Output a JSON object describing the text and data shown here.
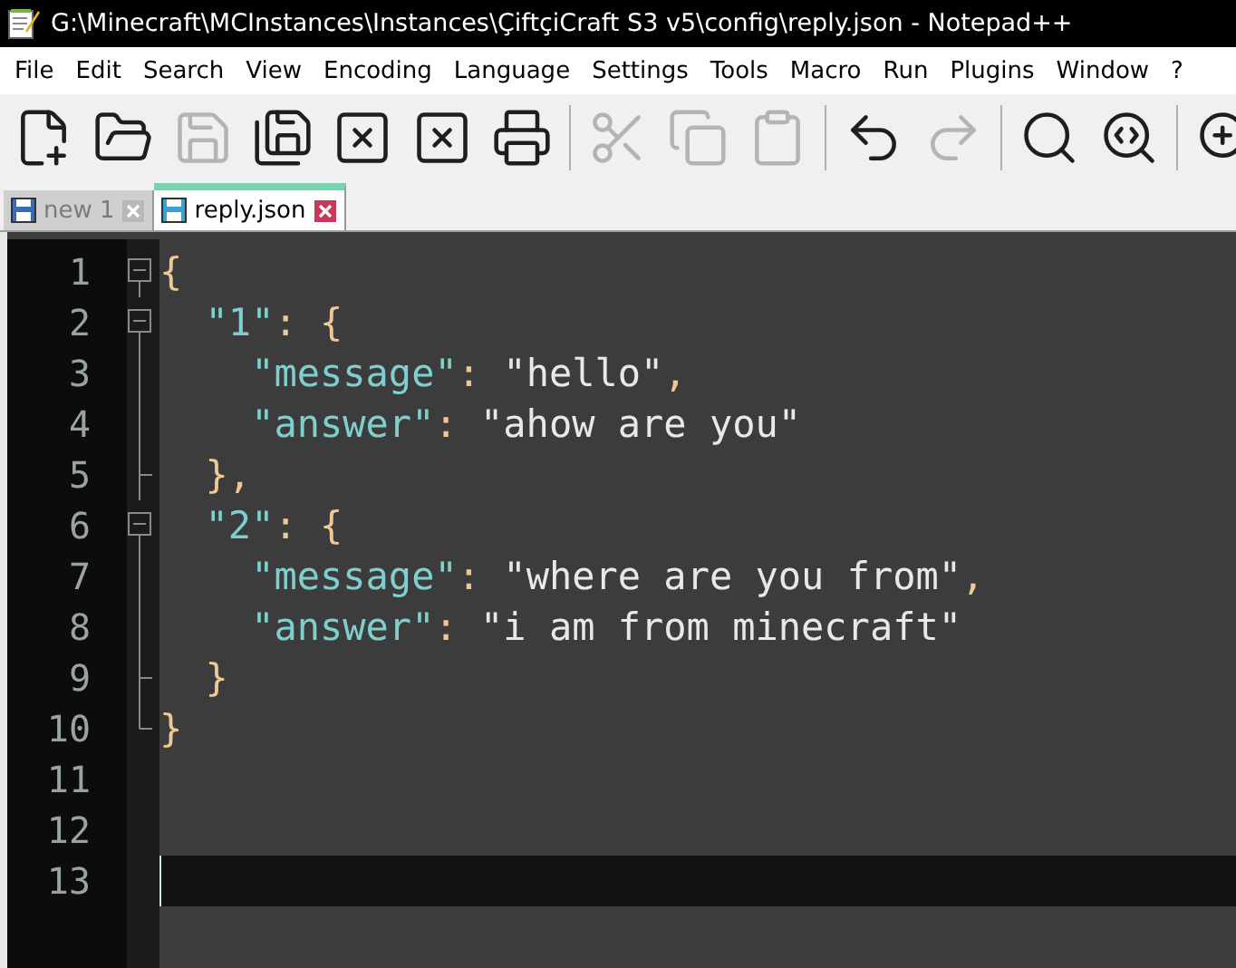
{
  "window": {
    "title": "G:\\Minecraft\\MCInstances\\Instances\\ÇiftçiCraft S3 v5\\config\\reply.json - Notepad++"
  },
  "menu": [
    "File",
    "Edit",
    "Search",
    "View",
    "Encoding",
    "Language",
    "Settings",
    "Tools",
    "Macro",
    "Run",
    "Plugins",
    "Window",
    "?"
  ],
  "toolbar": [
    {
      "kind": "new",
      "disabled": false
    },
    {
      "kind": "open",
      "disabled": false
    },
    {
      "kind": "save",
      "disabled": true
    },
    {
      "kind": "saveall",
      "disabled": false
    },
    {
      "kind": "close",
      "disabled": false
    },
    {
      "kind": "closeall",
      "disabled": false
    },
    {
      "kind": "print",
      "disabled": false
    },
    {
      "kind": "sep"
    },
    {
      "kind": "cut",
      "disabled": true
    },
    {
      "kind": "copy",
      "disabled": true
    },
    {
      "kind": "paste",
      "disabled": true
    },
    {
      "kind": "sep"
    },
    {
      "kind": "undo",
      "disabled": false
    },
    {
      "kind": "redo",
      "disabled": true
    },
    {
      "kind": "sep"
    },
    {
      "kind": "find",
      "disabled": false
    },
    {
      "kind": "replace",
      "disabled": false
    },
    {
      "kind": "sep"
    },
    {
      "kind": "zoomin",
      "disabled": false
    }
  ],
  "tabs": [
    {
      "label": "new 1",
      "selected": false
    },
    {
      "label": "reply.json",
      "selected": true
    }
  ],
  "editor": {
    "lines": [
      {
        "number": "1",
        "kind": "open",
        "current": false,
        "tokens": [
          {
            "kind": "punct",
            "text": "{"
          }
        ]
      },
      {
        "number": "2",
        "kind": "open",
        "current": false,
        "tokens": [
          {
            "kind": "key",
            "text": "  \"1\""
          },
          {
            "kind": "punct",
            "text": ": {"
          }
        ]
      },
      {
        "number": "3",
        "kind": "inner",
        "current": false,
        "tokens": [
          {
            "kind": "key",
            "text": "    \"message\""
          },
          {
            "kind": "punct",
            "text": ": "
          },
          {
            "kind": "string",
            "text": "\"hello\""
          },
          {
            "kind": "punct",
            "text": ","
          }
        ]
      },
      {
        "number": "4",
        "kind": "inner",
        "current": false,
        "tokens": [
          {
            "kind": "key",
            "text": "    \"answer\""
          },
          {
            "kind": "punct",
            "text": ": "
          },
          {
            "kind": "string",
            "text": "\"ahow are you\""
          }
        ]
      },
      {
        "number": "5",
        "kind": "end",
        "current": false,
        "tokens": [
          {
            "kind": "punct",
            "text": "  },"
          }
        ]
      },
      {
        "number": "6",
        "kind": "open",
        "current": false,
        "tokens": [
          {
            "kind": "key",
            "text": "  \"2\""
          },
          {
            "kind": "punct",
            "text": ": {"
          }
        ]
      },
      {
        "number": "7",
        "kind": "inner",
        "current": false,
        "tokens": [
          {
            "kind": "key",
            "text": "    \"message\""
          },
          {
            "kind": "punct",
            "text": ": "
          },
          {
            "kind": "string",
            "text": "\"where are you from\""
          },
          {
            "kind": "punct",
            "text": ","
          }
        ]
      },
      {
        "number": "8",
        "kind": "inner",
        "current": false,
        "tokens": [
          {
            "kind": "key",
            "text": "    \"answer\""
          },
          {
            "kind": "punct",
            "text": ": "
          },
          {
            "kind": "string",
            "text": "\"i am from minecraft\""
          }
        ]
      },
      {
        "number": "9",
        "kind": "end",
        "current": false,
        "tokens": [
          {
            "kind": "punct",
            "text": "  }"
          }
        ]
      },
      {
        "number": "10",
        "kind": "last",
        "current": false,
        "tokens": [
          {
            "kind": "punct",
            "text": "}"
          }
        ]
      },
      {
        "number": "11",
        "kind": "plain",
        "current": false
      },
      {
        "number": "12",
        "kind": "plain",
        "current": false
      },
      {
        "number": "13",
        "kind": "plain",
        "current": true
      }
    ]
  }
}
